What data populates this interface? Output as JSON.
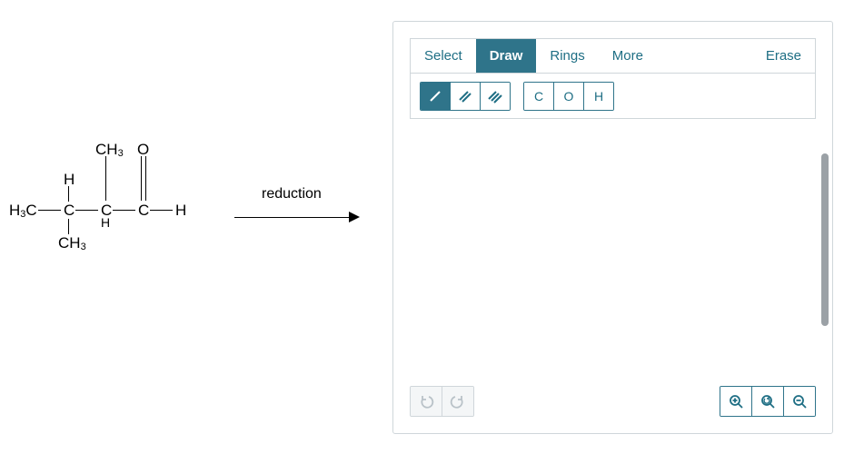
{
  "reaction": {
    "label": "reduction"
  },
  "molecule": {
    "atoms": {
      "h3c_left": "H3C",
      "c1_top_sub": "H",
      "c1": "C",
      "c1_bot_sub": "CH3",
      "c2_top_sub": "CH3",
      "c2": "C",
      "c2_bot_sub": "H",
      "c3": "C",
      "c3_top_sub": "O",
      "c3_right_sub": "H"
    }
  },
  "editor": {
    "tabs": {
      "select": "Select",
      "draw": "Draw",
      "rings": "Rings",
      "more": "More",
      "erase": "Erase",
      "active": "draw"
    },
    "bond_tools": [
      "single",
      "double",
      "triple"
    ],
    "active_bond_tool": "single",
    "atom_tools": [
      "C",
      "O",
      "H"
    ],
    "history": {
      "undo_enabled": false,
      "redo_enabled": false
    },
    "zoom_tools": [
      "zoom-in",
      "zoom-reset",
      "zoom-out"
    ]
  },
  "colors": {
    "accent": "#2f748a",
    "accent_text": "#1e6e84",
    "border": "#cfd6da",
    "disabled": "#b9c2c8"
  }
}
